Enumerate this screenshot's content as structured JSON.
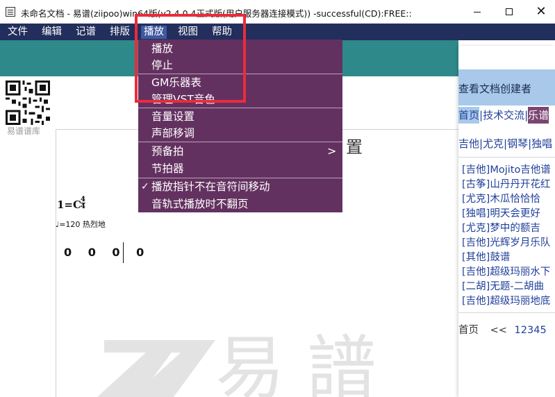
{
  "window": {
    "title": "未命名文档 - 易谱(ziipoo)win64版(v2.4.0.4正式版(用户服务器连接模式)) -successful(CD):FREE::"
  },
  "menubar": {
    "items": [
      "文件",
      "编辑",
      "记谱",
      "排版",
      "播放",
      "视图",
      "帮助"
    ],
    "active": "播放"
  },
  "dropdown": {
    "items": [
      {
        "label": "播放"
      },
      {
        "label": "停止"
      },
      {
        "label": "GM乐器表"
      },
      {
        "label": "管理VST音色"
      },
      {
        "label": "音量设置"
      },
      {
        "label": "声部移调"
      },
      {
        "label": "预备拍",
        "submenu": ">"
      },
      {
        "label": "节拍器"
      },
      {
        "label": "播放指针不在音符间移动",
        "check": "✓"
      },
      {
        "label": "音轨式播放时不翻页"
      }
    ]
  },
  "left_panel": {
    "caption": "易谱谱库"
  },
  "document": {
    "title": "置",
    "key": "1=C",
    "time_top": "4",
    "time_bottom": "4",
    "tempo": "♩=120  热烈地",
    "notes": "0 0 0 0",
    "watermark_text": "易 譜"
  },
  "right_panel": {
    "creator_link": "查看文档创建者",
    "nav": [
      "首页",
      "技术交流",
      "乐谱"
    ],
    "categories": "吉他|尤克|钢琴|独唱",
    "scores": [
      "[吉他]Mojito吉他谱",
      "[古筝]山丹丹开花红",
      "[尤克]木瓜恰恰恰",
      "[独唱]明天会更好",
      "[尤克]梦中的额吉",
      "[吉他]光辉岁月乐队",
      "[其他]鼓谱",
      "[吉他]超级玛丽水下",
      "[二胡]无题-二胡曲",
      "[吉他]超级玛丽地底"
    ],
    "pager": {
      "first": "首页",
      "prev": "<<",
      "pages": [
        "1",
        "2",
        "3",
        "4",
        "5"
      ]
    }
  },
  "colors": {
    "menubar": "#222e5c",
    "dropdown_bg": "#633160",
    "teal_band": "#2e8a8a",
    "highlight_box": "#ec2b3b",
    "link": "#1f3f9a"
  }
}
